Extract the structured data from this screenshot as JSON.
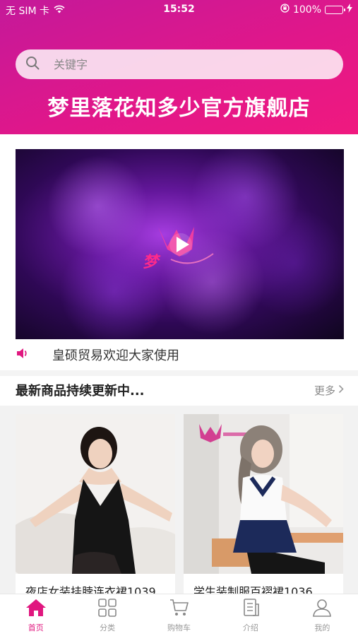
{
  "status_bar": {
    "carrier": "无 SIM 卡",
    "time": "15:52",
    "battery": "100%"
  },
  "search": {
    "placeholder": "关键字"
  },
  "store_title": "梦里落花知多少官方旗舰店",
  "banner": {
    "logo_text": "梦"
  },
  "notice": {
    "text": "皇硕贸易欢迎大家使用"
  },
  "section": {
    "title": "最新商品持续更新中...",
    "more_label": "更多"
  },
  "products": [
    {
      "name": "夜店女装挂脖连衣裙1039"
    },
    {
      "name": "学生装制服百褶裙1036"
    }
  ],
  "tabs": [
    {
      "label": "首页",
      "icon": "home-icon",
      "active": true
    },
    {
      "label": "分类",
      "icon": "grid-icon",
      "active": false
    },
    {
      "label": "购物车",
      "icon": "cart-icon",
      "active": false
    },
    {
      "label": "介绍",
      "icon": "document-icon",
      "active": false
    },
    {
      "label": "我的",
      "icon": "user-icon",
      "active": false
    }
  ],
  "colors": {
    "accent": "#e0177f",
    "header_start": "#c4199a",
    "header_end": "#f0197f"
  }
}
